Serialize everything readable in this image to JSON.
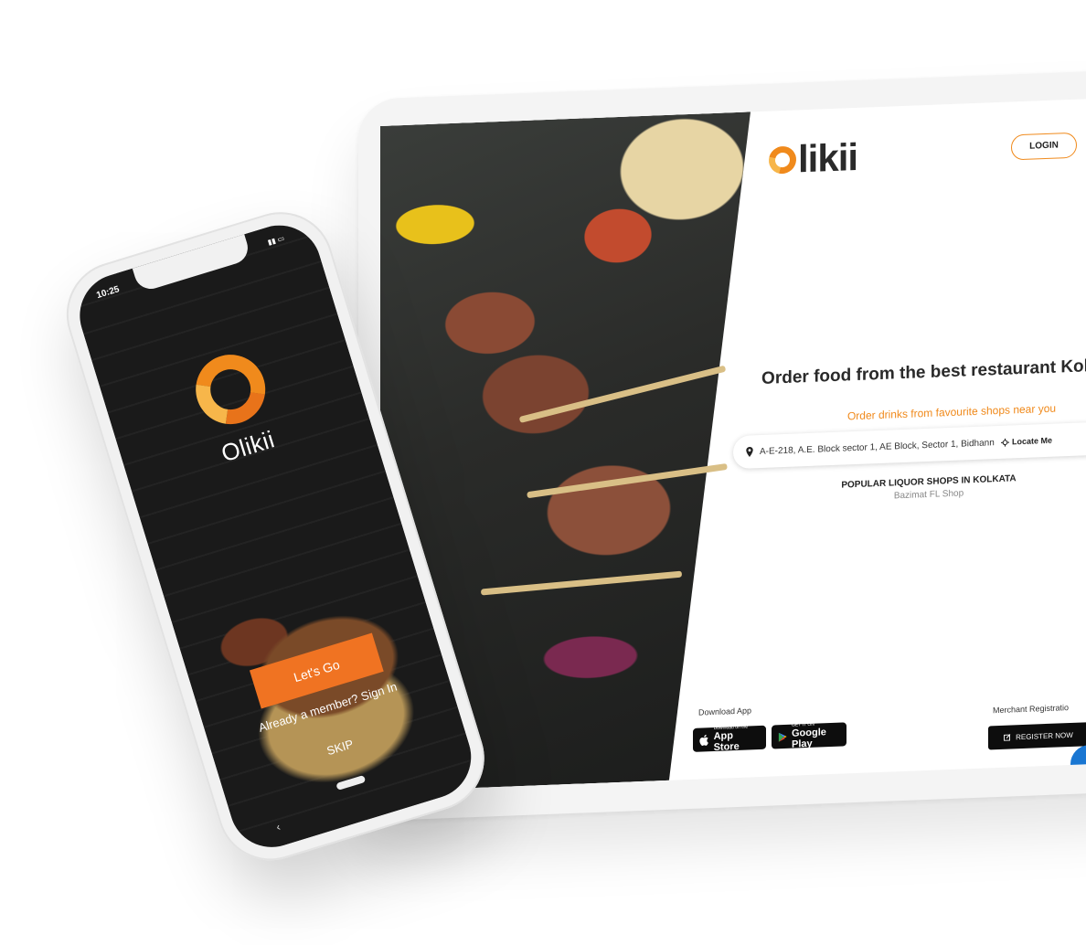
{
  "tablet": {
    "brand": "likii",
    "login_label": "LOGIN",
    "hero_title": "Order food from the best restaurant Kolkata",
    "hero_subtitle": "Order drinks from favourite shops near you",
    "search": {
      "value": "A-E-218, A.E. Block sector 1, AE Block, Sector 1, Bidhann",
      "locate_label": "Locate Me",
      "icon": "map-pin-icon"
    },
    "popular": {
      "title": "POPULAR LIQUOR SHOPS IN KOLKATA",
      "item": "Bazimat FL Shop"
    },
    "download": {
      "label": "Download App",
      "app_store_small": "Download on the",
      "app_store_big": "App Store",
      "play_small": "GET IT ON",
      "play_big": "Google Play"
    },
    "merchant": {
      "label": "Merchant Registratio",
      "register_label": "REGISTER NOW"
    },
    "colors": {
      "accent": "#f08a1c",
      "dark": "#0d0d0d",
      "chat": "#1976d2"
    }
  },
  "phone": {
    "status_time": "10:25",
    "brand": "Olikii",
    "cta_label": "Let's Go",
    "signin_text": "Already a member? Sign In",
    "skip_label": "SKIP",
    "colors": {
      "cta": "#f07322"
    }
  }
}
